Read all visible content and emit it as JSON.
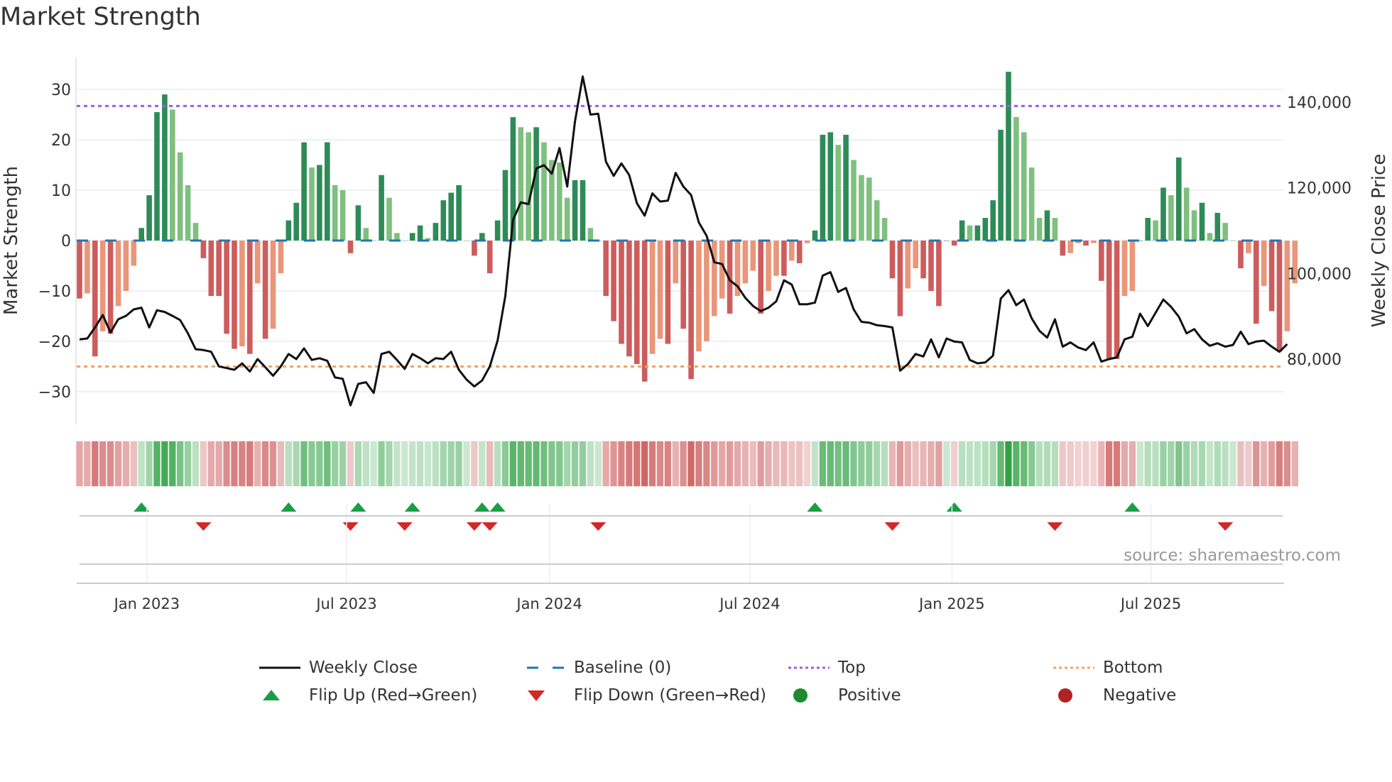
{
  "chart_data": {
    "type": "bar",
    "title": "Market Strength",
    "ylabel": "Market Strength",
    "y2label": "Weekly Close Price",
    "ylim": [
      -38,
      38
    ],
    "y_ticks": [
      30,
      20,
      10,
      0,
      -10,
      -20,
      -30
    ],
    "y_tick_labels": [
      "30",
      "20",
      "10",
      "0",
      "−10",
      "−20",
      "−30"
    ],
    "y2lim": [
      64000,
      152000
    ],
    "y2_ticks": [
      140000,
      120000,
      100000,
      80000
    ],
    "y2_tick_labels": [
      "140,000",
      "120,000",
      "100,000",
      "80,000"
    ],
    "x_ticks": [
      {
        "week": 8.7,
        "label": "Jan 2023"
      },
      {
        "week": 34.5,
        "label": "Jul 2023"
      },
      {
        "week": 60.7,
        "label": "Jan 2024"
      },
      {
        "week": 86.6,
        "label": "Jul 2024"
      },
      {
        "week": 112.7,
        "label": "Jan 2025"
      },
      {
        "week": 138.4,
        "label": "Jul 2025"
      }
    ],
    "top_level": 26.7,
    "bottom_level": -25,
    "baseline": 0,
    "strength": [
      -11.5,
      -10.5,
      -23,
      -18,
      -18.5,
      -13,
      -10,
      -5,
      2.5,
      9,
      25.5,
      29,
      26,
      17.5,
      11,
      3.5,
      -3.5,
      -11,
      -11,
      -18.5,
      -21.5,
      -21,
      -22.5,
      -8.5,
      -19.5,
      -17.5,
      -6.5,
      4,
      7.5,
      19.5,
      14.5,
      15,
      19.5,
      11,
      10,
      -2.5,
      7,
      2.5,
      0,
      13,
      8.5,
      1.5,
      0,
      1.5,
      3,
      0.5,
      3.5,
      8,
      9.5,
      11,
      0,
      -3,
      1.5,
      -6.5,
      4,
      14,
      24.5,
      22.5,
      21.5,
      22.5,
      19.5,
      16,
      15.5,
      8.5,
      12,
      12,
      2.5,
      0,
      -11,
      -16,
      -20.5,
      -23,
      -24.5,
      -28,
      -22.5,
      -19.5,
      -20.5,
      -8.5,
      -17.5,
      -27.5,
      -22,
      -20,
      -15,
      -11.5,
      -14.5,
      -11,
      -8.5,
      -6,
      -14.5,
      -10,
      -7,
      -7,
      -4,
      -4.5,
      -0.5,
      2,
      21,
      21.5,
      19,
      21,
      16,
      13,
      12.5,
      8,
      4.5,
      -7.5,
      -15,
      -9.5,
      -5.5,
      -7.5,
      -10,
      -13,
      0,
      -1,
      4,
      3,
      3,
      4.5,
      8,
      22,
      33.5,
      24.5,
      21.5,
      14.5,
      4.5,
      6,
      4.5,
      -3,
      -2.5,
      -0.5,
      -1,
      -0.5,
      -8,
      -23.5,
      -23.5,
      -11,
      -10,
      0,
      4.5,
      4,
      10.5,
      9,
      16.5,
      10.5,
      6,
      7.5,
      1.5,
      5.5,
      3.5,
      0,
      -5.5,
      -2.5,
      -16.5,
      -9,
      -14,
      -22,
      -18,
      -8.5
    ],
    "weekly_close": [
      84600,
      84800,
      87400,
      90300,
      86200,
      89300,
      90100,
      91600,
      92000,
      87400,
      91400,
      91000,
      90100,
      89100,
      86000,
      82300,
      82100,
      81700,
      78300,
      77900,
      77500,
      79000,
      77100,
      80000,
      78100,
      76100,
      78300,
      81200,
      80000,
      82500,
      79800,
      80200,
      79600,
      75700,
      75400,
      69200,
      74200,
      74600,
      72100,
      81200,
      81700,
      79800,
      77700,
      81200,
      80200,
      79000,
      80200,
      80000,
      81700,
      77500,
      75200,
      73600,
      75000,
      78300,
      84300,
      94700,
      112500,
      116600,
      116200,
      124500,
      125300,
      123300,
      129300,
      120300,
      135500,
      146000,
      137100,
      137300,
      126100,
      122800,
      125700,
      123000,
      116400,
      113500,
      118700,
      116800,
      117000,
      123500,
      120300,
      118300,
      111900,
      108800,
      102600,
      102200,
      98400,
      97000,
      94300,
      92400,
      91200,
      92000,
      93500,
      98400,
      97400,
      92800,
      92800,
      93200,
      99500,
      100300,
      95700,
      96600,
      91600,
      88700,
      88500,
      87900,
      87700,
      87400,
      77300,
      78800,
      81200,
      80600,
      84600,
      80400,
      84800,
      84100,
      83900,
      79800,
      79000,
      79200,
      80800,
      94100,
      96100,
      92600,
      93900,
      89500,
      86600,
      85000,
      89300,
      82900,
      83900,
      82700,
      82100,
      83900,
      79400,
      80000,
      80400,
      84600,
      85200,
      90600,
      87700,
      90800,
      93900,
      92200,
      89900,
      86000,
      87000,
      84600,
      83100,
      83700,
      82900,
      83300,
      86400,
      83500,
      84100,
      84300,
      82900,
      81700,
      83500
    ],
    "flip_up_weeks": [
      8,
      27,
      36,
      43,
      52,
      54,
      95,
      113,
      136
    ],
    "flip_down_weeks": [
      16,
      35,
      42,
      51,
      53,
      67,
      105,
      126,
      148
    ],
    "source": "source: sharemaestro.com",
    "legend": [
      {
        "label": "Weekly Close",
        "symbol": "line-solid",
        "color": "#111111"
      },
      {
        "label": "Baseline (0)",
        "symbol": "line-dashed",
        "color": "#1f77b4"
      },
      {
        "label": "Top",
        "symbol": "line-dotted",
        "color": "#9b5de5"
      },
      {
        "label": "Bottom",
        "symbol": "line-dotted",
        "color": "#f4a261"
      },
      {
        "label": "Flip Up (Red→Green)",
        "symbol": "triangle-up",
        "color": "#1a9e45"
      },
      {
        "label": "Flip Down (Green→Red)",
        "symbol": "triangle-down",
        "color": "#d62728"
      },
      {
        "label": "Positive",
        "symbol": "circle",
        "color": "#1e8a2e"
      },
      {
        "label": "Negative",
        "symbol": "circle",
        "color": "#b22222"
      }
    ],
    "colors": {
      "pos_strong": "#2e8b57",
      "pos_weak": "#7fbf7f",
      "neg_strong": "#cd5c5c",
      "neg_weak": "#e9967a",
      "heat_pos": "#2ea043",
      "heat_neg": "#c85050"
    }
  }
}
